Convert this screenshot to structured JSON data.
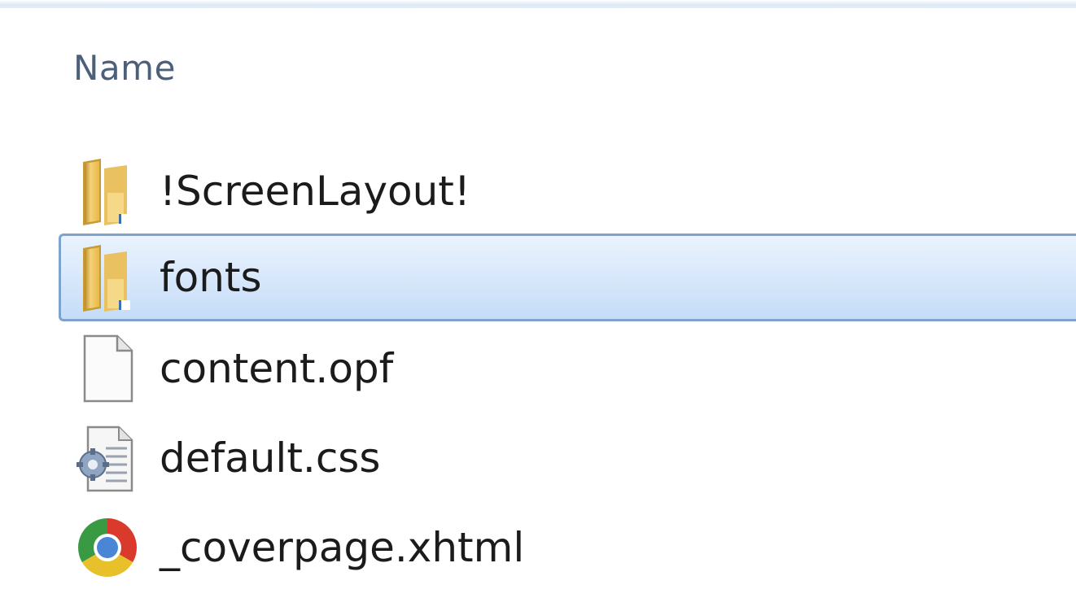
{
  "header": {
    "name_column": "Name"
  },
  "files": [
    {
      "name": "!ScreenLayout!",
      "icon": "folder-icon",
      "selected": false
    },
    {
      "name": "fonts",
      "icon": "folder-icon",
      "selected": true
    },
    {
      "name": "content.opf",
      "icon": "blank-file-icon",
      "selected": false
    },
    {
      "name": "default.css",
      "icon": "css-settings-file-icon",
      "selected": false
    },
    {
      "name": "_coverpage.xhtml",
      "icon": "chrome-icon",
      "selected": false
    }
  ],
  "colors": {
    "selection_border": "#7da2ce",
    "selection_fill": "#c5dcf8",
    "header_text": "#4c607a"
  }
}
